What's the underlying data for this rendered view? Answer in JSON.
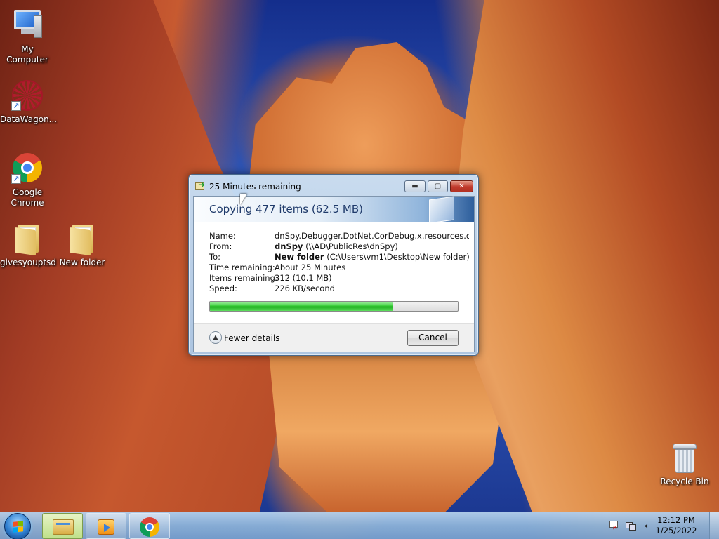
{
  "desktop": {
    "icons": [
      {
        "label": "My Computer",
        "icon": "computer-icon"
      },
      {
        "label": "DataWagon...",
        "icon": "datawagon-icon"
      },
      {
        "label": "Google Chrome",
        "icon": "chrome-icon"
      },
      {
        "label": "givesyouptsd",
        "icon": "folder-icon"
      },
      {
        "label": "New folder",
        "icon": "folder-icon"
      },
      {
        "label": "Recycle Bin",
        "icon": "recycle-bin-icon"
      }
    ]
  },
  "dialog": {
    "title": "25 Minutes remaining",
    "buttons": {
      "minimize": "▬",
      "maximize": "▢",
      "close": "✕"
    },
    "heading": "Copying 477 items (62.5 MB)",
    "details": {
      "name_label": "Name:",
      "name_value": "dnSpy.Debugger.DotNet.CorDebug.x.resources.dll",
      "from_label": "From:",
      "from_bold": "dnSpy",
      "from_path": "(\\\\AD\\PublicRes\\dnSpy)",
      "to_label": "To:",
      "to_bold": "New folder",
      "to_path": "(C:\\Users\\vm1\\Desktop\\New folder)",
      "time_label": "Time remaining:",
      "time_value": "About 25 Minutes",
      "items_label": "Items remaining:",
      "items_value": "312 (10.1 MB)",
      "speed_label": "Speed:",
      "speed_value": "226 KB/second"
    },
    "progress_fraction": 0.74,
    "fewer_details_label": "Fewer details",
    "cancel_label": "Cancel"
  },
  "taskbar": {
    "pinned": [
      "explorer-icon",
      "media-player-icon",
      "chrome-icon"
    ],
    "clock_time": "12:12 PM",
    "clock_date": "1/25/2022"
  }
}
